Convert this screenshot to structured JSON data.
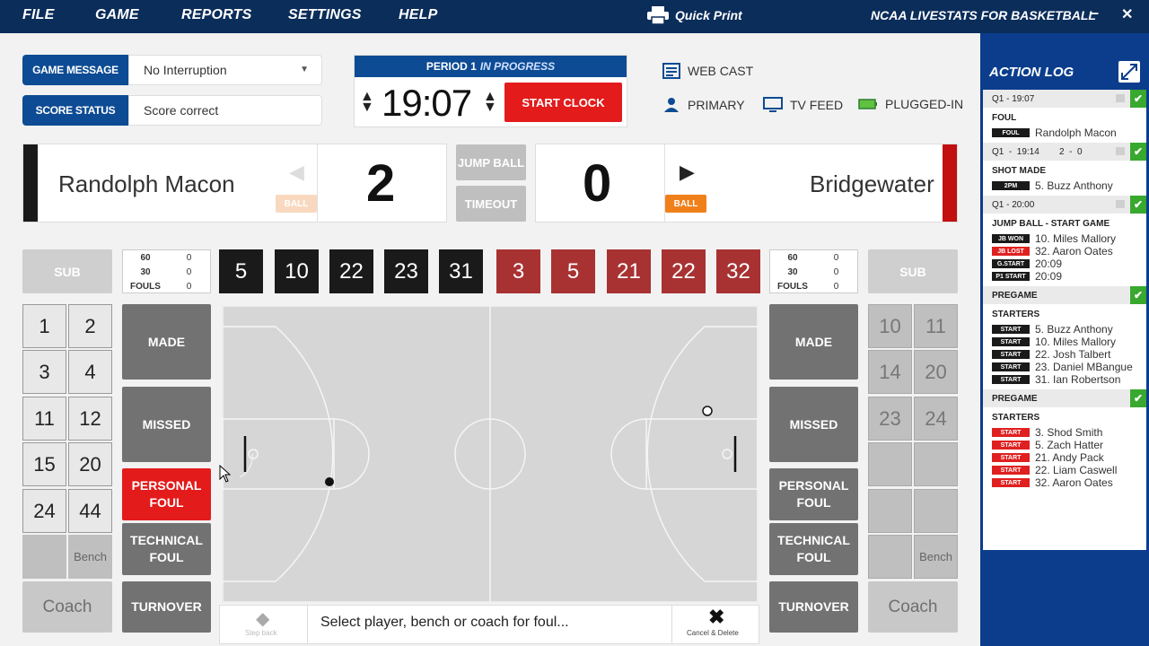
{
  "menu": {
    "file": "FILE",
    "game": "GAME",
    "reports": "REPORTS",
    "settings": "SETTINGS",
    "help": "HELP",
    "quick_print": "Quick Print",
    "app_title": "NCAA LIVESTATS FOR BASKETBALL",
    "minimize": "–",
    "close": "✕"
  },
  "game_message": {
    "label": "GAME MESSAGE",
    "value": "No Interruption"
  },
  "score_status": {
    "label": "SCORE STATUS",
    "value": "Score correct"
  },
  "period": {
    "label": "PERIOD 1",
    "status": "IN PROGRESS",
    "clock": "19:07",
    "start_clock": "START CLOCK"
  },
  "feeds": {
    "web_cast": "WEB CAST",
    "primary": "PRIMARY",
    "tv_feed": "TV FEED",
    "plugged_in": "PLUGGED-IN"
  },
  "home": {
    "name": "Randolph Macon",
    "score": "2",
    "ball": "BALL",
    "color": "#1a1a1a",
    "sub": "SUB",
    "stats": [
      {
        "label": "60",
        "value": "0"
      },
      {
        "label": "30",
        "value": "0"
      },
      {
        "label": "FOULS",
        "value": "0"
      }
    ],
    "on_court": [
      "5",
      "10",
      "22",
      "23",
      "31"
    ],
    "bench_numbers": [
      "1",
      "2",
      "3",
      "4",
      "11",
      "12",
      "15",
      "20",
      "24",
      "44"
    ],
    "bench": "Bench",
    "coach": "Coach"
  },
  "away": {
    "name": "Bridgewater",
    "score": "0",
    "ball": "BALL",
    "color": "#c20f0f",
    "sub": "SUB",
    "stats": [
      {
        "label": "60",
        "value": "0"
      },
      {
        "label": "30",
        "value": "0"
      },
      {
        "label": "FOULS",
        "value": "0"
      }
    ],
    "on_court": [
      "3",
      "5",
      "21",
      "22",
      "32"
    ],
    "bench_numbers": [
      "10",
      "11",
      "14",
      "20",
      "23",
      "24"
    ],
    "bench": "Bench",
    "coach": "Coach"
  },
  "center_buttons": {
    "jump_ball": "JUMP BALL",
    "timeout": "TIMEOUT"
  },
  "actions": {
    "made": "MADE",
    "missed": "MISSED",
    "personal_foul_1": "PERSONAL",
    "personal_foul_2": "FOUL",
    "technical_foul_1": "TECHNICAL",
    "technical_foul_2": "FOUL",
    "turnover": "TURNOVER"
  },
  "prompt": {
    "step_back": "Step back",
    "text": "Select player, bench or coach for foul...",
    "cancel": "Cancel & Delete"
  },
  "action_log": {
    "title": "ACTION LOG",
    "entries": [
      {
        "head": "Q1  -  19:07",
        "title": "FOUL",
        "lines": [
          {
            "tag": "FOUL",
            "style": "black",
            "text": "Randolph Macon"
          }
        ]
      },
      {
        "head": "Q1  -  19:14        2  -  0",
        "title": "SHOT MADE",
        "lines": [
          {
            "tag": "2PM",
            "style": "black",
            "text": "5. Buzz Anthony"
          }
        ]
      },
      {
        "head": "Q1  -  20:00",
        "title": "JUMP BALL - START GAME",
        "lines": [
          {
            "tag": "JB WON",
            "style": "black",
            "text": "10. Miles Mallory"
          },
          {
            "tag": "JB LOST",
            "style": "red",
            "text": "32. Aaron Oates"
          },
          {
            "tag": "G.START",
            "style": "black",
            "text": "20:09"
          },
          {
            "tag": "P1 START",
            "style": "black",
            "text": "20:09"
          }
        ]
      },
      {
        "head": "PREGAME",
        "title": "STARTERS",
        "lines": [
          {
            "tag": "START",
            "style": "black",
            "text": "5. Buzz Anthony"
          },
          {
            "tag": "START",
            "style": "black",
            "text": "10. Miles Mallory"
          },
          {
            "tag": "START",
            "style": "black",
            "text": "22. Josh Talbert"
          },
          {
            "tag": "START",
            "style": "black",
            "text": "23. Daniel MBangue"
          },
          {
            "tag": "START",
            "style": "black",
            "text": "31. Ian Robertson"
          }
        ]
      },
      {
        "head": "PREGAME",
        "title": "STARTERS",
        "lines": [
          {
            "tag": "START",
            "style": "red",
            "text": "3. Shod Smith"
          },
          {
            "tag": "START",
            "style": "red",
            "text": "5. Zach Hatter"
          },
          {
            "tag": "START",
            "style": "red",
            "text": "21. Andy Pack"
          },
          {
            "tag": "START",
            "style": "red",
            "text": "22. Liam Caswell"
          },
          {
            "tag": "START",
            "style": "red",
            "text": "32. Aaron Oates"
          }
        ]
      }
    ]
  },
  "colors": {
    "nav": "#0b2d5a",
    "accent": "#0d4b94",
    "foul_red": "#e31b1b",
    "away_jersey": "#a83232",
    "ball_orange": "#f0801a",
    "check_green": "#38a82f"
  }
}
